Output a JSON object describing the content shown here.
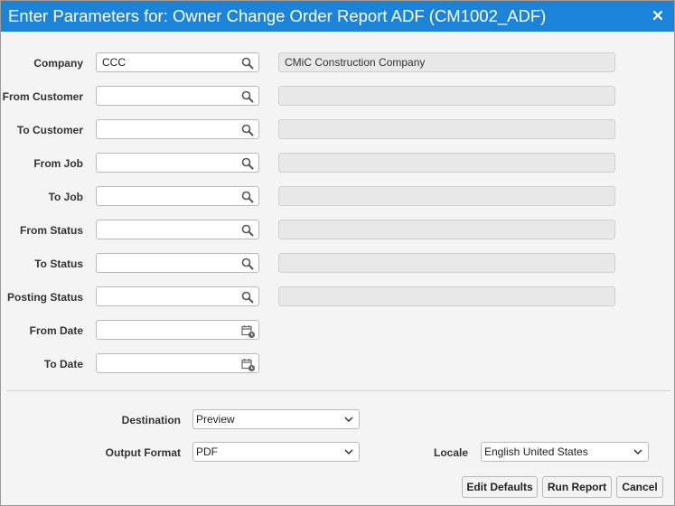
{
  "dialog": {
    "title": "Enter Parameters for: Owner Change Order Report ADF (CM1002_ADF)",
    "close_icon": "close-icon"
  },
  "parameters": [
    {
      "label": "Company",
      "value": "CCC",
      "description": "CMiC Construction Company",
      "icon": "search-icon"
    },
    {
      "label": "From Customer",
      "value": "",
      "description": "",
      "icon": "search-icon"
    },
    {
      "label": "To Customer",
      "value": "",
      "description": "",
      "icon": "search-icon"
    },
    {
      "label": "From Job",
      "value": "",
      "description": "",
      "icon": "search-icon"
    },
    {
      "label": "To Job",
      "value": "",
      "description": "",
      "icon": "search-icon"
    },
    {
      "label": "From Status",
      "value": "",
      "description": "",
      "icon": "search-icon"
    },
    {
      "label": "To Status",
      "value": "",
      "description": "",
      "icon": "search-icon"
    },
    {
      "label": "Posting Status",
      "value": "",
      "description": "",
      "icon": "search-icon"
    },
    {
      "label": "From Date",
      "value": "",
      "icon": "calendar-icon"
    },
    {
      "label": "To Date",
      "value": "",
      "icon": "calendar-icon"
    }
  ],
  "output": {
    "destination_label": "Destination",
    "destination_value": "Preview",
    "format_label": "Output Format",
    "format_value": "PDF",
    "locale_label": "Locale",
    "locale_value": "English United States"
  },
  "buttons": {
    "edit_defaults": "Edit Defaults",
    "run_report": "Run Report",
    "cancel": "Cancel"
  },
  "colors": {
    "title_bar": "#1b84d9",
    "background": "#f4f4f4",
    "readonly_field": "#e8e8e8"
  }
}
